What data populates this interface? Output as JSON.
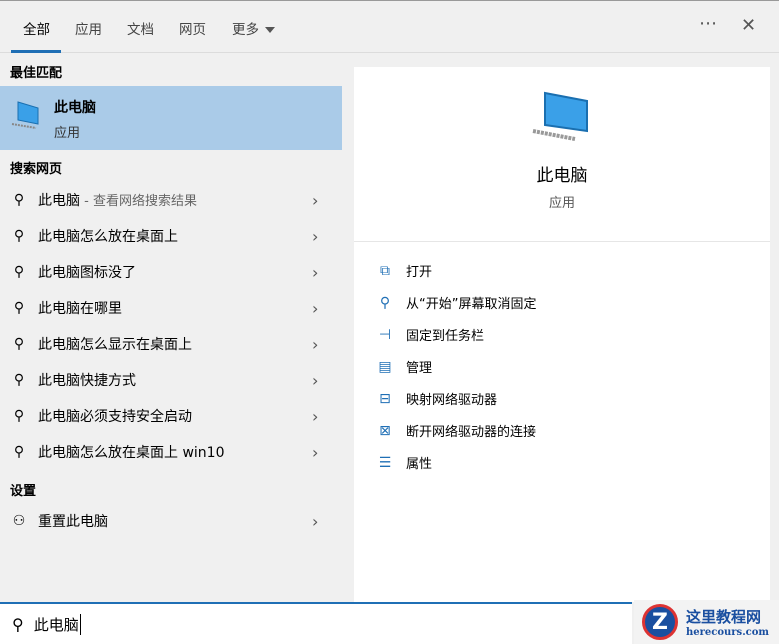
{
  "tabs": [
    "全部",
    "应用",
    "文档",
    "网页",
    "更多"
  ],
  "sections": {
    "best_match": "最佳匹配",
    "web": "搜索网页",
    "settings": "设置"
  },
  "best": {
    "title": "此电脑",
    "type": "应用"
  },
  "web_results": [
    {
      "main": "此电脑",
      "sub": " - 查看网络搜索结果"
    },
    {
      "main": "此电脑怎么放在桌面上"
    },
    {
      "main": "此电脑图标没了"
    },
    {
      "main": "此电脑在哪里"
    },
    {
      "main": "此电脑怎么显示在桌面上"
    },
    {
      "main": "此电脑快捷方式"
    },
    {
      "main": "此电脑必须支持安全启动"
    },
    {
      "main": "此电脑怎么放在桌面上 win10"
    }
  ],
  "settings_results": [
    {
      "main": "重置此电脑"
    }
  ],
  "detail": {
    "title": "此电脑",
    "type": "应用",
    "actions": [
      {
        "label": "打开",
        "icon": "open-icon"
      },
      {
        "label": "从“开始”屏幕取消固定",
        "icon": "unpin-icon"
      },
      {
        "label": "固定到任务栏",
        "icon": "pin-icon"
      },
      {
        "label": "管理",
        "icon": "manage-icon"
      },
      {
        "label": "映射网络驱动器",
        "icon": "map-drive-icon"
      },
      {
        "label": "断开网络驱动器的连接",
        "icon": "disconnect-drive-icon"
      },
      {
        "label": "属性",
        "icon": "properties-icon"
      }
    ]
  },
  "search": {
    "value": "此电脑"
  },
  "watermark": {
    "name": "这里教程网",
    "url": "herecours.com"
  },
  "colors": {
    "accent": "#1f6fb5",
    "selected": "#aacbe8"
  }
}
